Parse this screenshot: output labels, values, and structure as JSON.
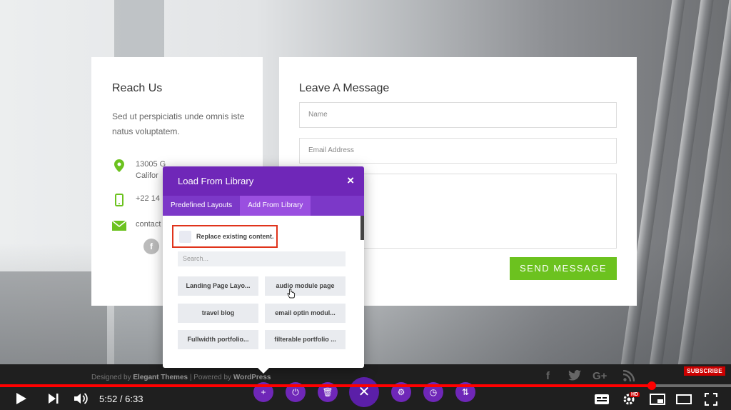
{
  "reach_us": {
    "title": "Reach Us",
    "description": "Sed ut perspiciatis unde omnis iste natus voluptatem.",
    "address_line1": "13005 G",
    "address_line2": "Califor",
    "phone": "+22 14",
    "email": "contact",
    "location_icon": "map-pin-icon",
    "phone_icon": "phone-icon",
    "mail_icon": "envelope-icon",
    "facebook_glyph": "f"
  },
  "leave_message": {
    "title": "Leave A Message",
    "name_placeholder": "Name",
    "email_placeholder": "Email Address",
    "message_placeholder": "",
    "send_label": "SEND MESSAGE"
  },
  "footer": {
    "designed_by": "Designed by",
    "elegant": "Elegant Themes",
    "separator": " | Powered by ",
    "wordpress": "WordPress",
    "social": [
      "f",
      "t",
      "G+",
      "rss"
    ]
  },
  "library_modal": {
    "title": "Load From Library",
    "close_glyph": "×",
    "tabs": [
      {
        "label": "Predefined Layouts",
        "active": false
      },
      {
        "label": "Add From Library",
        "active": true
      }
    ],
    "replace_label": "Replace existing content.",
    "search_placeholder": "Search...",
    "items": [
      "Landing Page Layo...",
      "audio module page",
      "travel blog",
      "email optin modul...",
      "Fullwidth portfolio...",
      "filterable portfolio ..."
    ]
  },
  "builder_bar": {
    "buttons": [
      "+",
      "⏻",
      "🗑",
      "✕",
      "⚙",
      "◷",
      "⇅"
    ]
  },
  "player": {
    "current_time": "5:52",
    "total_time": "6:33",
    "time_display": "5:52 / 6:33",
    "progress": 0.892,
    "subscribe_label": "SUBSCRIBE",
    "hd_label": "HD"
  },
  "colors": {
    "accent_green": "#6cc21f",
    "divi_purple": "#6f27b8",
    "highlight_red": "#e0331b",
    "youtube_red": "#ff0000"
  }
}
